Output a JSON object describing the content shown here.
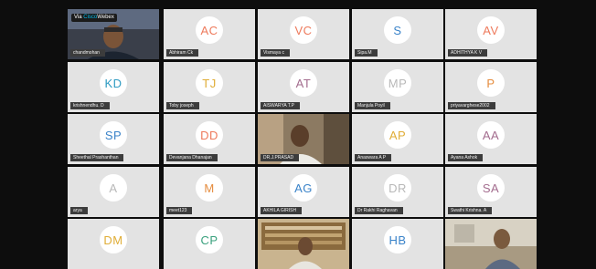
{
  "meeting": {
    "badge": {
      "prefix": "Via",
      "brand": "Cisco",
      "product": "Webex"
    }
  },
  "participants": [
    {
      "name": "chandmohan",
      "initials": "",
      "video": "man-blue"
    },
    {
      "name": "Abhiram Ck",
      "initials": "AC",
      "color": "#ee7a5c"
    },
    {
      "name": "Vismaya c",
      "initials": "VC",
      "color": "#ee7a5c"
    },
    {
      "name": "Sipa.M",
      "initials": "S",
      "color": "#3a83c9"
    },
    {
      "name": "ADHITHYA K V",
      "initials": "AV",
      "color": "#ee7a5c"
    },
    {
      "name": "krishnendhu. D",
      "initials": "KD",
      "color": "#2e9bc2"
    },
    {
      "name": "Toby joseph",
      "initials": "TJ",
      "color": "#e0ad36"
    },
    {
      "name": "AISWARYA T.P",
      "initials": "AT",
      "color": "#a36c8e"
    },
    {
      "name": "Manjula Poyil",
      "initials": "MP",
      "color": "#b8b8b8"
    },
    {
      "name": "priyavarghese2002",
      "initials": "P",
      "color": "#e58c3e"
    },
    {
      "name": "Sheethal Prashanthan",
      "initials": "SP",
      "color": "#3a83c9"
    },
    {
      "name": "Devanjana Dhanajan",
      "initials": "DD",
      "color": "#ee7a5c"
    },
    {
      "name": "DR.J.PRASAD",
      "initials": "",
      "video": "man-white"
    },
    {
      "name": "Anaswara A P",
      "initials": "AP",
      "color": "#e0ad36"
    },
    {
      "name": "Ayana Ashok",
      "initials": "AA",
      "color": "#a36c8e"
    },
    {
      "name": "arya",
      "initials": "A",
      "color": "#b8b8b8"
    },
    {
      "name": "meet123",
      "initials": "M",
      "color": "#e58c3e"
    },
    {
      "name": "AKHILA GIRISH",
      "initials": "AG",
      "color": "#3a83c9"
    },
    {
      "name": "Dr Rakhi Raghavan",
      "initials": "DR",
      "color": "#b8b8b8"
    },
    {
      "name": "Swathi Krishna. A",
      "initials": "SA",
      "color": "#a36c8e"
    },
    {
      "name": "",
      "initials": "DM",
      "color": "#e0ad36"
    },
    {
      "name": "",
      "initials": "CP",
      "color": "#3aa17e"
    },
    {
      "name": "",
      "initials": "",
      "video": "library"
    },
    {
      "name": "",
      "initials": "HB",
      "color": "#3a83c9"
    },
    {
      "name": "",
      "initials": "",
      "video": "office"
    }
  ]
}
